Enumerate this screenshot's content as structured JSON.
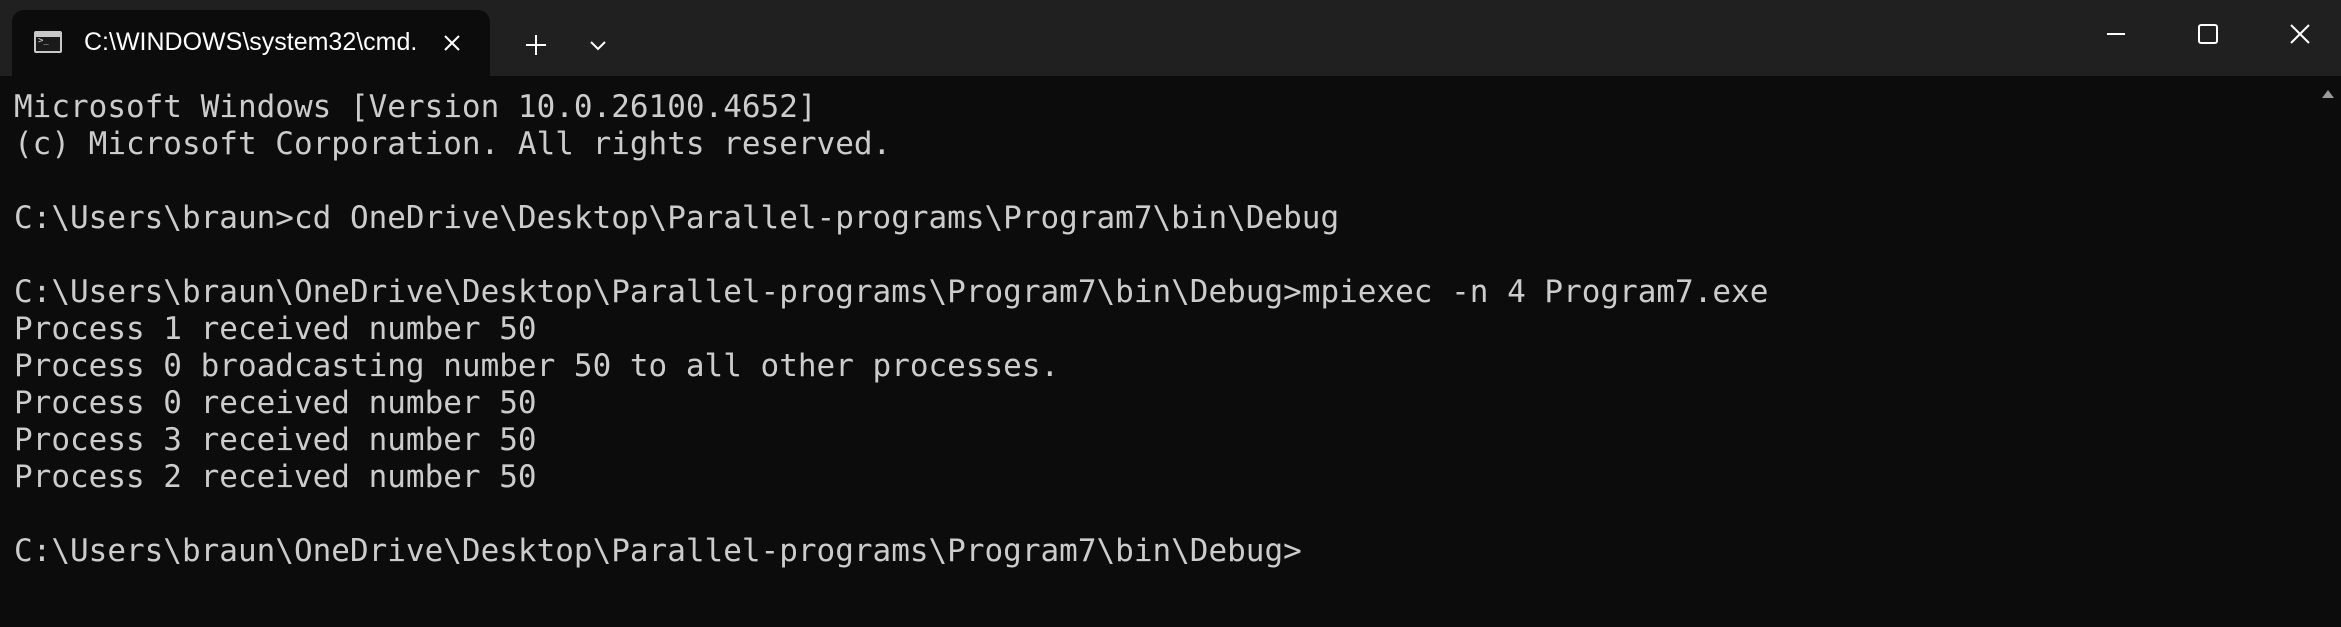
{
  "tab": {
    "title": "C:\\WINDOWS\\system32\\cmd.",
    "icon": "terminal-icon"
  },
  "titlebar": {
    "new_tab_icon": "plus-icon",
    "dropdown_icon": "chevron-down-icon",
    "minimize_icon": "minimize-icon",
    "maximize_icon": "maximize-icon",
    "close_icon": "close-icon"
  },
  "terminal": {
    "lines": [
      "Microsoft Windows [Version 10.0.26100.4652]",
      "(c) Microsoft Corporation. All rights reserved.",
      "",
      "C:\\Users\\braun>cd OneDrive\\Desktop\\Parallel-programs\\Program7\\bin\\Debug",
      "",
      "C:\\Users\\braun\\OneDrive\\Desktop\\Parallel-programs\\Program7\\bin\\Debug>mpiexec -n 4 Program7.exe",
      "Process 1 received number 50",
      "Process 0 broadcasting number 50 to all other processes.",
      "Process 0 received number 50",
      "Process 3 received number 50",
      "Process 2 received number 50",
      "",
      "C:\\Users\\braun\\OneDrive\\Desktop\\Parallel-programs\\Program7\\bin\\Debug>"
    ],
    "foreground": "#cccccc",
    "background": "#0c0c0c"
  }
}
